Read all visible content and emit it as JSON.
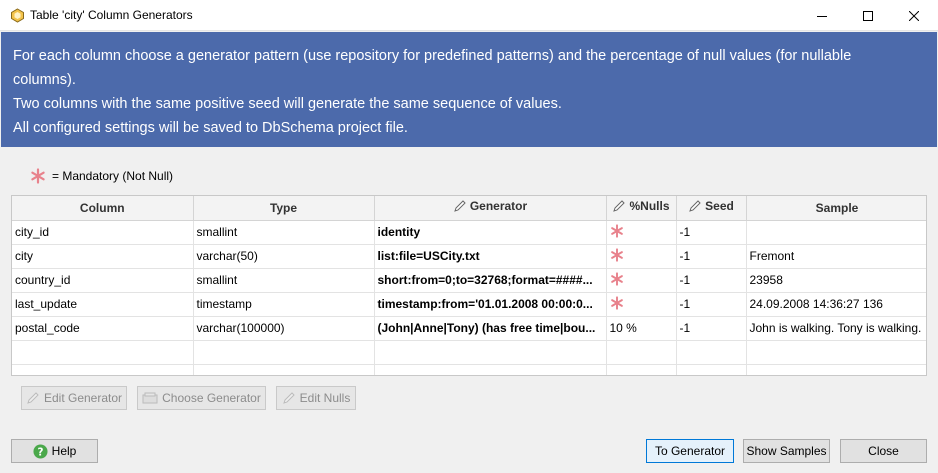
{
  "window": {
    "title": "Table 'city' Column Generators"
  },
  "banner": {
    "lines": [
      "For each column choose a generator pattern (use repository for predefined patterns) and the percentage of null values (for nullable",
      "columns).",
      "Two columns with the same positive seed will generate the same sequence of values.",
      "All configured settings will be saved to DbSchema project file."
    ]
  },
  "legend": {
    "text": "= Mandatory (Not Null)"
  },
  "table": {
    "headers": {
      "column": "Column",
      "type": "Type",
      "generator": "Generator",
      "nulls": "%Nulls",
      "seed": "Seed",
      "sample": "Sample"
    },
    "rows": [
      {
        "column": "city_id",
        "type": "smallint",
        "generator": "identity",
        "nulls": "",
        "seed": "-1",
        "sample": ""
      },
      {
        "column": "city",
        "type": "varchar(50)",
        "generator": "list:file=USCity.txt",
        "nulls": "",
        "seed": "-1",
        "sample": "Fremont"
      },
      {
        "column": "country_id",
        "type": "smallint",
        "generator": "short:from=0;to=32768;format=####...",
        "nulls": "",
        "seed": "-1",
        "sample": "23958"
      },
      {
        "column": "last_update",
        "type": "timestamp",
        "generator": "timestamp:from='01.01.2008 00:00:0...",
        "nulls": "",
        "seed": "-1",
        "sample": "24.09.2008 14:36:27 136"
      },
      {
        "column": "postal_code",
        "type": "varchar(100000)",
        "generator": "(John|Anne|Tony) (has free time|bou...",
        "nulls": "10 %",
        "seed": "-1",
        "sample": "John is walking. Tony is walking."
      }
    ]
  },
  "buttons": {
    "edit_generator": "Edit Generator",
    "choose_generator": "Choose Generator",
    "edit_nulls": "Edit Nulls",
    "help": "Help",
    "to_generator": "To Generator",
    "show_samples": "Show Samples",
    "close": "Close"
  },
  "colors": {
    "banner": "#4c6aab",
    "mandatory": "#e8828c",
    "help": "#4aa84a"
  }
}
